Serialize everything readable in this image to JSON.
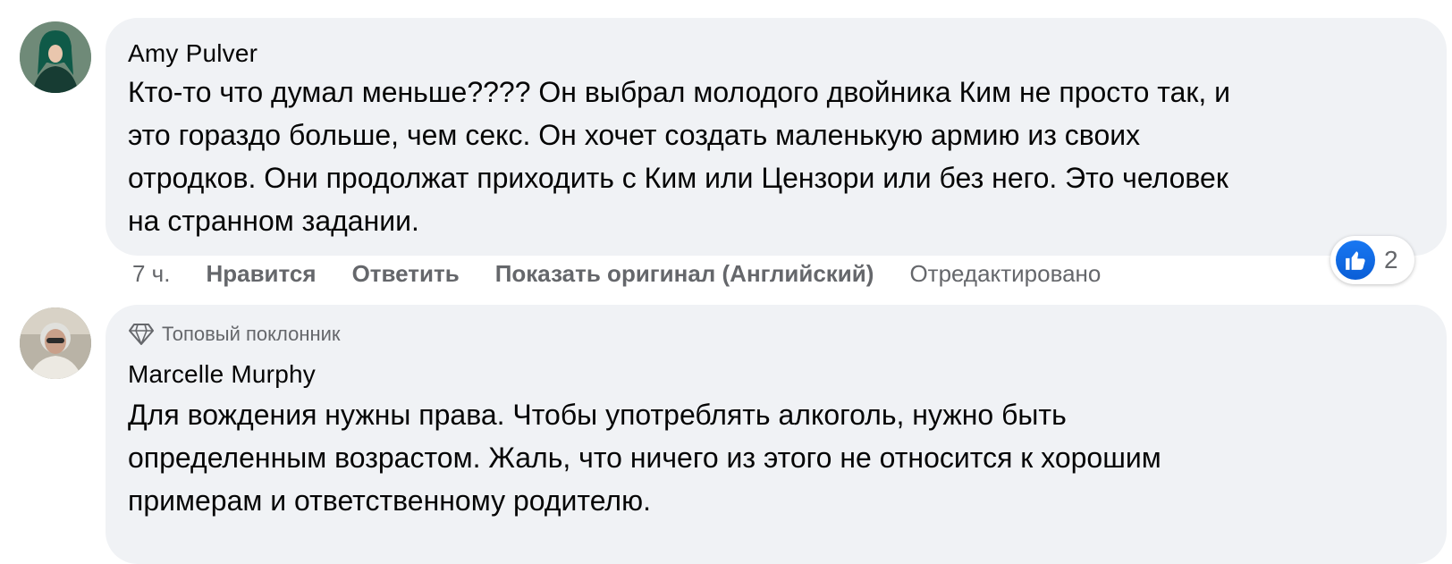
{
  "comments": [
    {
      "author": "Amy Pulver",
      "lines": [
        "Кто-то что думал меньше???? Он выбрал молодого двойника Ким не просто так, и",
        "это гораздо больше, чем секс. Он хочет создать маленькую армию из своих",
        "отродков. Они продолжат приходить с Ким или Цензори или без него. Это человек",
        "на странном задании."
      ],
      "time": "7 ч.",
      "like_label": "Нравится",
      "reply_label": "Ответить",
      "show_original_label": "Показать оригинал (Английский)",
      "edited_label": "Отредактировано",
      "reaction_count": "2",
      "reaction_icon": "thumbs-up-icon",
      "avatar_colors": [
        "#1e5c4c",
        "#0f2a24"
      ]
    },
    {
      "badge": "Топовый поклонник",
      "badge_icon": "diamond-icon",
      "author": "Marcelle Murphy",
      "lines": [
        "Для вождения нужны права. Чтобы употреблять алкоголь, нужно быть",
        "определенным возрастом. Жаль, что ничего из этого не относится к хорошим",
        "примерам и ответственному родителю."
      ],
      "avatar_colors": [
        "#c7c2b8",
        "#3a3a3a"
      ]
    }
  ],
  "colors": {
    "bubble": "#f0f2f5",
    "text": "#050505",
    "meta": "#65676b",
    "like_blue": "#1877f2"
  }
}
